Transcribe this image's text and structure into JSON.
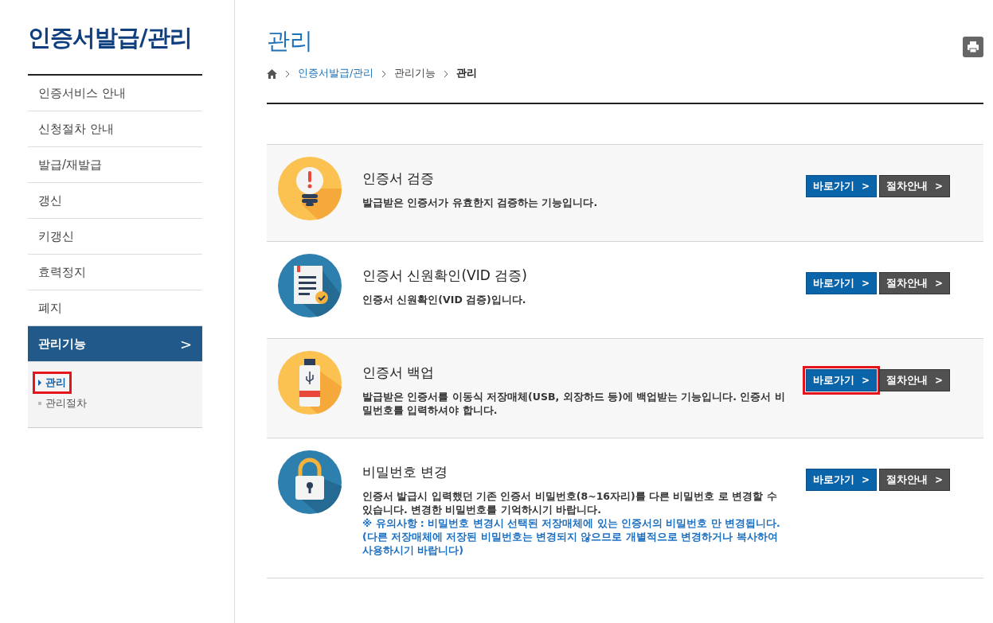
{
  "sidebar": {
    "title": "인증서발급/관리",
    "items": [
      {
        "label": "인증서비스 안내",
        "selected": false
      },
      {
        "label": "신청절차 안내",
        "selected": false
      },
      {
        "label": "발급/재발급",
        "selected": false
      },
      {
        "label": "갱신",
        "selected": false
      },
      {
        "label": "키갱신",
        "selected": false
      },
      {
        "label": "효력정지",
        "selected": false
      },
      {
        "label": "폐지",
        "selected": false
      },
      {
        "label": "관리기능",
        "selected": true,
        "arrow": ">",
        "children": [
          {
            "label": "관리",
            "selected": true,
            "highlighted": true
          },
          {
            "label": "관리절차",
            "selected": false,
            "highlighted": false
          }
        ]
      }
    ]
  },
  "page": {
    "title": "관리",
    "breadcrumb": [
      {
        "label": "인증서발급/관리",
        "kind": "link"
      },
      {
        "label": "관리기능",
        "kind": "plain"
      },
      {
        "label": "관리",
        "kind": "current"
      }
    ],
    "cards": [
      {
        "kind": "bulb",
        "title": "인증서 검증",
        "description": [
          {
            "text": "발급받은 인증서가 유효한지 검증하는 기능입니다.",
            "kind": "normal"
          }
        ],
        "buttons": [
          {
            "label": "바로가기",
            "arrow": ">",
            "kind": "primary",
            "highlighted": false
          },
          {
            "label": "절차안내",
            "arrow": ">",
            "kind": "secondary",
            "highlighted": false
          }
        ]
      },
      {
        "kind": "document",
        "title": "인증서 신원확인(VID 검증)",
        "description": [
          {
            "text": "인증서 신원확인(VID 검증)입니다.",
            "kind": "normal"
          }
        ],
        "buttons": [
          {
            "label": "바로가기",
            "arrow": ">",
            "kind": "primary",
            "highlighted": false
          },
          {
            "label": "절차안내",
            "arrow": ">",
            "kind": "secondary",
            "highlighted": false
          }
        ]
      },
      {
        "kind": "usb",
        "title": "인증서 백업",
        "description": [
          {
            "text": "발급받은 인증서를 이동식 저장매체(USB, 외장하드 등)에 백업받는 기능입니다. 인증서 비밀번호를 입력하셔야 합니다.",
            "kind": "normal"
          }
        ],
        "buttons": [
          {
            "label": "바로가기",
            "arrow": ">",
            "kind": "primary",
            "highlighted": true
          },
          {
            "label": "절차안내",
            "arrow": ">",
            "kind": "secondary",
            "highlighted": false
          }
        ]
      },
      {
        "kind": "lock",
        "title": "비밀번호 변경",
        "description": [
          {
            "text": "인증서 발급시 입력했던 기존 인증서 비밀번호(8~16자리)를 다른 비밀번호 로 변경할 수 있습니다. 변경한 비밀번호를 기억하시기 바랍니다.",
            "kind": "normal"
          },
          {
            "text": "※ 유의사항 : 비밀번호 변경시 선택된 저장매체에 있는 인증서의 비밀번호 만 변경됩니다. (다른 저장매체에 저장된 비밀번호는 변경되지 않으므로 개별적으로 변경하거나 복사하여 사용하시기 바랍니다)",
            "kind": "note"
          }
        ],
        "buttons": [
          {
            "label": "바로가기",
            "arrow": ">",
            "kind": "primary",
            "highlighted": false
          },
          {
            "label": "절차안내",
            "arrow": ">",
            "kind": "secondary",
            "highlighted": false
          }
        ]
      }
    ]
  }
}
